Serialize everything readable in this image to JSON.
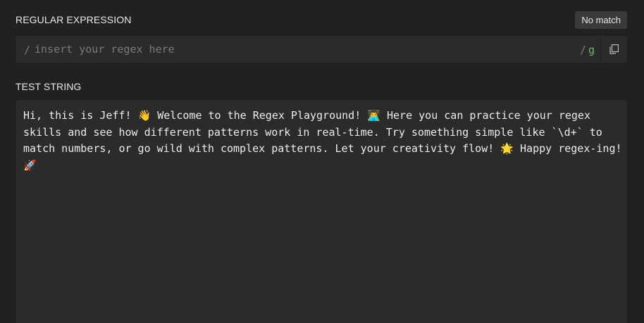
{
  "regex_section": {
    "label": "REGULAR EXPRESSION",
    "match_status": "No match",
    "open_delimiter": "/",
    "placeholder": "insert your regex here",
    "value": "",
    "close_delimiter": "/",
    "flags": "g",
    "copy_icon": "copy-icon"
  },
  "test_section": {
    "label": "TEST STRING",
    "text": "Hi, this is Jeff! 👋 Welcome to the Regex Playground! 👨‍💻 Here you can practice your regex skills and see how different patterns work in real-time. Try something simple like `\\d+` to match numbers, or go wild with complex patterns. Let your creativity flow! 🌟 Happy regex-ing! 🚀"
  },
  "colors": {
    "background": "#212121",
    "panel": "#2b2b2b",
    "badge": "#3a3a3a",
    "flag": "#6fb36b"
  }
}
